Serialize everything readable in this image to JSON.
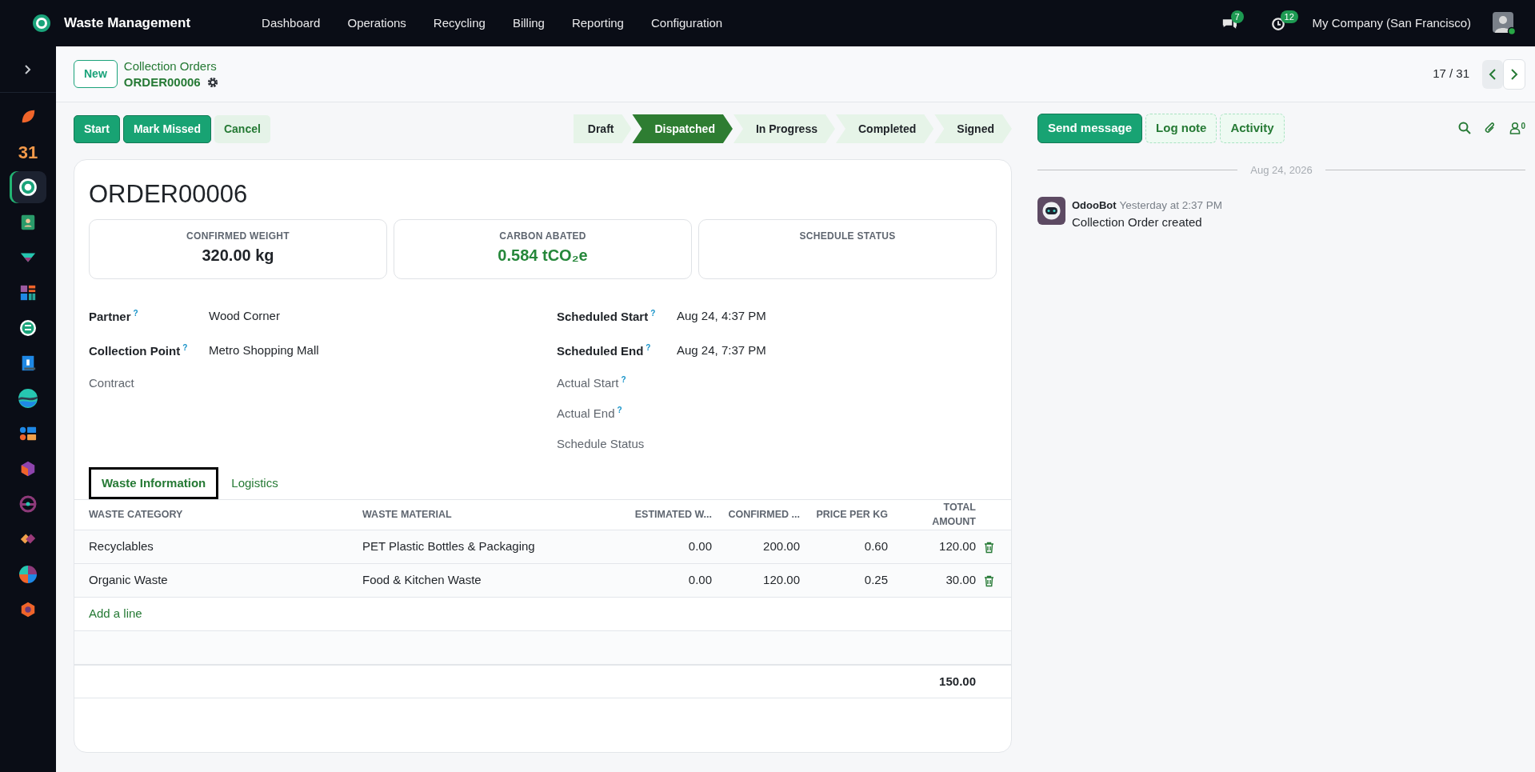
{
  "topbar": {
    "app_name": "Waste Management",
    "menu": [
      "Dashboard",
      "Operations",
      "Recycling",
      "Billing",
      "Reporting",
      "Configuration"
    ],
    "messages_count": "7",
    "activities_count": "12",
    "company": "My Company (San Francisco)"
  },
  "sidebar": {
    "apps": [
      {
        "selected": false
      },
      {
        "label": "31",
        "selected": false
      },
      {
        "selected": true
      },
      {
        "selected": false
      },
      {
        "selected": false
      },
      {
        "selected": false
      },
      {
        "selected": false
      },
      {
        "selected": false
      },
      {
        "selected": false
      },
      {
        "selected": false
      },
      {
        "selected": false
      },
      {
        "selected": false
      },
      {
        "selected": false
      },
      {
        "selected": false
      },
      {
        "selected": false
      }
    ]
  },
  "control_panel": {
    "new_button": "New",
    "breadcrumb": "Collection Orders",
    "record": "ORDER00006",
    "pager": "17 / 31"
  },
  "actions": [
    {
      "label": "Start",
      "kind": "primary"
    },
    {
      "label": "Mark Missed",
      "kind": "primary"
    },
    {
      "label": "Cancel",
      "kind": "secondary"
    }
  ],
  "stages": [
    {
      "label": "Draft",
      "selected": false
    },
    {
      "label": "Dispatched",
      "selected": true
    },
    {
      "label": "In Progress",
      "selected": false
    },
    {
      "label": "Completed",
      "selected": false
    },
    {
      "label": "Signed",
      "selected": false
    }
  ],
  "form": {
    "title": "ORDER00006",
    "stats": [
      {
        "label": "CONFIRMED WEIGHT",
        "value": "320.00 kg",
        "kind": "plain"
      },
      {
        "label": "CARBON ABATED",
        "value": "0.584 tCO₂e",
        "kind": "positive"
      },
      {
        "label": "SCHEDULE STATUS"
      }
    ],
    "left_fields": [
      {
        "label": "Partner",
        "help": "?",
        "required": true,
        "value": "Wood Corner"
      },
      {
        "label": "Collection Point",
        "help": "?",
        "required": true,
        "value": "Metro Shopping Mall"
      },
      {
        "label": "Contract",
        "required": false
      }
    ],
    "right_fields": [
      {
        "label": "Scheduled Start",
        "help": "?",
        "required": true,
        "value": "Aug 24, 4:37 PM"
      },
      {
        "label": "Scheduled End",
        "help": "?",
        "required": true,
        "value": "Aug 24, 7:37 PM"
      },
      {
        "label": "Actual Start",
        "help": "?",
        "required": false
      },
      {
        "label": "Actual End",
        "help": "?",
        "required": false
      },
      {
        "label": "Schedule Status",
        "required": false
      }
    ],
    "tabs": [
      {
        "label": "Waste Information",
        "selected": true
      },
      {
        "label": "Logistics",
        "selected": false
      }
    ],
    "table": {
      "columns": [
        {
          "label": "WASTE CATEGORY",
          "kind": "text"
        },
        {
          "label": "WASTE MATERIAL",
          "kind": "text"
        },
        {
          "label": "ESTIMATED W...",
          "kind": "number"
        },
        {
          "label": "CONFIRMED ...",
          "kind": "number"
        },
        {
          "label": "PRICE PER KG",
          "kind": "number"
        },
        {
          "label": "TOTAL AMOUNT",
          "kind": "number"
        }
      ],
      "rows": [
        [
          "Recyclables",
          "PET Plastic Bottles & Packaging",
          "0.00",
          "200.00",
          "0.60",
          "120.00"
        ],
        [
          "Organic Waste",
          "Food & Kitchen Waste",
          "0.00",
          "120.00",
          "0.25",
          "30.00"
        ]
      ],
      "add_line": "Add a line",
      "total": "150.00"
    }
  },
  "chatter": {
    "buttons": [
      {
        "label": "Send message",
        "kind": "primary"
      },
      {
        "label": "Log note",
        "kind": "secondary"
      },
      {
        "label": "Activity",
        "kind": "secondary"
      }
    ],
    "followers_count": "0",
    "date_separator": "Aug 24, 2026",
    "messages": [
      {
        "author": "OdooBot",
        "time": "Yesterday at 2:37 PM",
        "body": "Collection Order created"
      }
    ]
  }
}
